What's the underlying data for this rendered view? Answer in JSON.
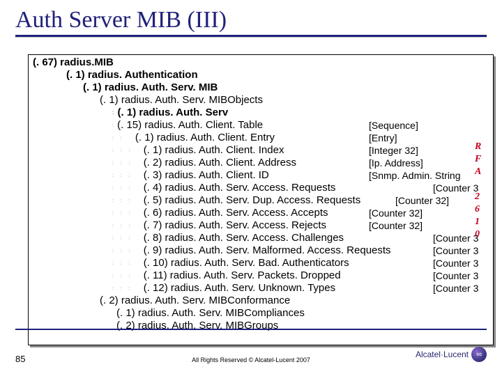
{
  "title": "Auth Server MIB (III)",
  "slide_number": "85",
  "copyright": "All Rights Reserved © Alcatel-Lucent 2007",
  "logo_text": "Alcatel·Lucent",
  "tree": {
    "l0": "(. 67) radius.MIB",
    "l1": "(. 1) radius. Authentication",
    "l2": "(. 1) radius. Auth. Serv. MIB",
    "l3": "(. 1) radius. Auth. Serv. MIBObjects",
    "l4": "(. 1) radius. Auth. Serv",
    "l5": "(. 15) radius. Auth. Client. Table",
    "l6": "(. 1) radius. Auth. Client. Entry",
    "l7": "(. 1) radius. Auth. Client. Index",
    "l8": "(. 2) radius. Auth. Client. Address",
    "l9": "(. 3) radius. Auth. Client. ID",
    "l10": "(. 4) radius. Auth. Serv. Access. Requests",
    "l11": "(. 5) radius. Auth. Serv. Dup. Access. Requests",
    "l12": "(. 6) radius. Auth. Serv. Access. Accepts",
    "l13": "(. 7) radius. Auth. Serv. Access. Rejects",
    "l14": "(. 8) radius. Auth. Serv. Access. Challenges",
    "l15": "(. 9) radius. Auth. Serv. Malformed. Access. Requests",
    "l16": "(. 10) radius. Auth. Serv. Bad. Authenticators",
    "l17": "(. 11) radius. Auth. Serv. Packets. Dropped",
    "l18": "(. 12) radius. Auth. Serv. Unknown. Types",
    "l19": "(. 2) radius. Auth. Serv. MIBConformance",
    "l20": "(. 1) radius. Auth. Serv. MIBCompliances",
    "l21": "(. 2) radius. Auth. Serv. MIBGroups"
  },
  "types": {
    "t0": "[Sequence]",
    "t1": "[Entry]",
    "t2": "[Integer 32]",
    "t3": "[Ip. Address]",
    "t4": "[Snmp. Admin. String",
    "t5": "[Counter 3",
    "t6": "[Counter 32]",
    "t7": "[Counter 32]",
    "t8": "[Counter 32]",
    "t9": "[Counter 3",
    "t10": "[Counter 3",
    "t11": "[Counter 3",
    "t12": "[Counter 3",
    "t13": "[Counter 3"
  },
  "red": {
    "r0": "R",
    "r1": "F",
    "r2": "A",
    "r3": "2",
    "r4": "6",
    "r5": "1",
    "r6": "0"
  }
}
